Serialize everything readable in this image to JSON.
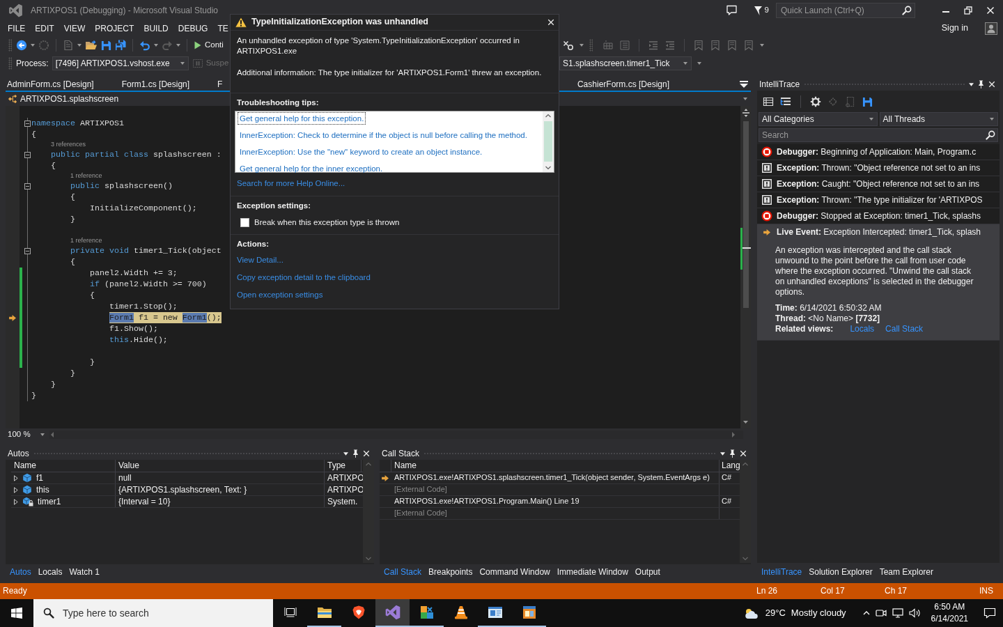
{
  "window": {
    "title": "ARTIXPOS1 (Debugging) - Microsoft Visual Studio",
    "notification_count": "9",
    "quick_launch": {
      "placeholder": "Quick Launch (Ctrl+Q)"
    },
    "sign_in": "Sign in"
  },
  "menu": [
    "FILE",
    "EDIT",
    "VIEW",
    "PROJECT",
    "BUILD",
    "DEBUG",
    "TE"
  ],
  "toolbar": {
    "continue": {
      "label": "Conti",
      "disabled": false
    },
    "process": {
      "label": "Process:",
      "value": "[7496] ARTIXPOS1.vshost.exe"
    },
    "suspend": {
      "label": "Suspe",
      "disabled": true
    },
    "stack_frame": {
      "value": "S1.splashscreen.timer1_Tick"
    }
  },
  "document_tabs": [
    {
      "label": "AdminForm.cs [Design]",
      "selected": false
    },
    {
      "label": "Form1.cs [Design]",
      "selected": false
    },
    {
      "label": "F",
      "selected": false
    },
    {
      "label": "CashierForm.cs [Design]",
      "selected": false
    }
  ],
  "editor": {
    "type_scope": "ARTIXPOS1.splashscreen",
    "zoom": "100 %",
    "lines": [
      {
        "kind": "header",
        "tokens": [
          {
            "text": "namespace",
            "kind": "keyword"
          },
          {
            "text": " ARTIXPOS1",
            "kind": "plain"
          }
        ],
        "expanded": true,
        "current": false,
        "changed": false
      },
      {
        "kind": "code",
        "tokens": [
          {
            "text": "{",
            "kind": "plain"
          }
        ],
        "current": false,
        "changed": false
      },
      {
        "kind": "lens",
        "text": "    3 references",
        "changed": false
      },
      {
        "kind": "header",
        "tokens": [
          {
            "text": "    public partial class",
            "kind": "keyword"
          },
          {
            "text": " splashscreen :",
            "kind": "plain"
          }
        ],
        "expanded": true,
        "current": false,
        "changed": false
      },
      {
        "kind": "code",
        "tokens": [
          {
            "text": "    {",
            "kind": "plain"
          }
        ],
        "current": false,
        "changed": false
      },
      {
        "kind": "lens",
        "text": "        1 reference",
        "changed": false
      },
      {
        "kind": "header",
        "tokens": [
          {
            "text": "        public",
            "kind": "keyword"
          },
          {
            "text": " splashscreen()",
            "kind": "plain"
          }
        ],
        "expanded": true,
        "current": false,
        "changed": false
      },
      {
        "kind": "code",
        "tokens": [
          {
            "text": "        {",
            "kind": "plain"
          }
        ],
        "current": false,
        "changed": false
      },
      {
        "kind": "code",
        "tokens": [
          {
            "text": "            InitializeComponent();",
            "kind": "plain"
          }
        ],
        "current": false,
        "changed": false
      },
      {
        "kind": "code",
        "tokens": [
          {
            "text": "        }",
            "kind": "plain"
          }
        ],
        "current": false,
        "changed": false
      },
      {
        "kind": "blank"
      },
      {
        "kind": "lens",
        "text": "        1 reference",
        "changed": false
      },
      {
        "kind": "header",
        "tokens": [
          {
            "text": "        private void",
            "kind": "keyword"
          },
          {
            "text": " timer1_Tick(object",
            "kind": "plain"
          }
        ],
        "expanded": true,
        "current": false,
        "changed": false
      },
      {
        "kind": "code",
        "tokens": [
          {
            "text": "        {",
            "kind": "plain"
          }
        ],
        "current": false,
        "changed": false
      },
      {
        "kind": "code",
        "tokens": [
          {
            "text": "            panel2.Width += 3;",
            "kind": "plain"
          }
        ],
        "current": false,
        "changed": true
      },
      {
        "kind": "code",
        "tokens": [
          {
            "text": "            if",
            "kind": "keyword"
          },
          {
            "text": " (panel2.Width >= 700)",
            "kind": "plain"
          }
        ],
        "current": false,
        "changed": true
      },
      {
        "kind": "code",
        "tokens": [
          {
            "text": "            {",
            "kind": "plain"
          }
        ],
        "current": false,
        "changed": true
      },
      {
        "kind": "code",
        "tokens": [
          {
            "text": "                timer1.Stop();",
            "kind": "plain"
          }
        ],
        "current": false,
        "changed": true
      },
      {
        "kind": "code",
        "tokens": [
          {
            "text": "                Form1",
            "kind": "reference"
          },
          {
            "text": " f1 = new ",
            "kind": "plain"
          },
          {
            "text": "Form1",
            "kind": "reference"
          },
          {
            "text": "();",
            "kind": "plain"
          }
        ],
        "current": true,
        "changed": true
      },
      {
        "kind": "code",
        "tokens": [
          {
            "text": "                f1.Show();",
            "kind": "plain"
          }
        ],
        "current": false,
        "changed": true
      },
      {
        "kind": "code",
        "tokens": [
          {
            "text": "                this",
            "kind": "keyword"
          },
          {
            "text": ".Hide();",
            "kind": "plain"
          }
        ],
        "current": false,
        "changed": true
      },
      {
        "kind": "blank"
      },
      {
        "kind": "code",
        "tokens": [
          {
            "text": "            }",
            "kind": "plain"
          }
        ],
        "current": false,
        "changed": true
      },
      {
        "kind": "code",
        "tokens": [
          {
            "text": "        }",
            "kind": "plain"
          }
        ],
        "current": false,
        "changed": false
      },
      {
        "kind": "code",
        "tokens": [
          {
            "text": "    }",
            "kind": "plain"
          }
        ],
        "current": false,
        "changed": false
      },
      {
        "kind": "code",
        "tokens": [
          {
            "text": "}",
            "kind": "plain"
          }
        ],
        "current": false,
        "changed": false
      }
    ]
  },
  "exception_dialog": {
    "title": "TypeInitializationException was unhandled",
    "message": "An unhandled exception of type 'System.TypeInitializationException' occurred in ARTIXPOS1.exe",
    "additional_info": "Additional information: The type initializer for 'ARTIXPOS1.Form1' threw an exception.",
    "tips_heading": "Troubleshooting tips:",
    "tips": [
      {
        "text": "Get general help for this exception.",
        "selected": true
      },
      {
        "text": "InnerException: Check to determine if the object is null before calling the method.",
        "selected": false
      },
      {
        "text": "InnerException: Use the \"new\" keyword to create an object instance.",
        "selected": false
      },
      {
        "text": "Get general help for the inner exception.",
        "selected": false
      }
    ],
    "help_link": "Search for more Help Online...",
    "settings_heading": "Exception settings:",
    "break_option": {
      "label": "Break when this exception type is thrown",
      "checked": false
    },
    "actions_heading": "Actions:",
    "actions": [
      "View Detail...",
      "Copy exception detail to the clipboard",
      "Open exception settings"
    ]
  },
  "intellitrace": {
    "title": "IntelliTrace",
    "category_filter": "All Categories",
    "thread_filter": "All Threads",
    "search": {
      "placeholder": "Search"
    },
    "events": [
      {
        "kind": "debugger",
        "text": "**Debugger:** Beginning of Application: Main, Program.c",
        "selected": false
      },
      {
        "kind": "exception",
        "text": "**Exception:** Thrown: \"Object reference not set to an ins",
        "selected": false
      },
      {
        "kind": "exception",
        "text": "**Exception:** Caught: \"Object reference not set to an ins",
        "selected": false
      },
      {
        "kind": "exception",
        "text": "**Exception:** Thrown: \"The type initializer for 'ARTIXPOS",
        "selected": false
      },
      {
        "kind": "debugger",
        "text": "**Debugger:** Stopped at Exception: timer1_Tick, splashs",
        "selected": false
      },
      {
        "kind": "live",
        "text": "**Live Event:** Exception Intercepted: timer1_Tick, splash",
        "selected": true,
        "details": {
          "description": "An exception was intercepted and the call stack unwound to the point before the call from user code where the exception occurred.  \"Unwind the call stack on unhandled exceptions\" is selected in the debugger options.",
          "time": "**Time:**  6/14/2021 6:50:32 AM",
          "thread": "**Thread:** <No Name> **[7732]**",
          "related_label": "Related views:",
          "related_links": [
            "Locals",
            "Call Stack"
          ]
        }
      }
    ],
    "tabs": [
      {
        "label": "IntelliTrace",
        "selected": true
      },
      {
        "label": "Solution Explorer",
        "selected": false
      },
      {
        "label": "Team Explorer",
        "selected": false
      }
    ]
  },
  "autos": {
    "title": "Autos",
    "columns": [
      "Name",
      "Value",
      "Type"
    ],
    "rows": [
      {
        "kind": "field",
        "name": "f1",
        "value": "null",
        "type": "ARTIXPO",
        "expanded": false
      },
      {
        "kind": "field",
        "name": "this",
        "value": "{ARTIXPOS1.splashscreen, Text: }",
        "type": "ARTIXPO",
        "expanded": false
      },
      {
        "kind": "private_field",
        "name": "timer1",
        "value": "{Interval = 10}",
        "type": "System.",
        "expanded": false
      }
    ],
    "tabs": [
      {
        "label": "Autos",
        "selected": true
      },
      {
        "label": "Locals",
        "selected": false
      },
      {
        "label": "Watch 1",
        "selected": false
      }
    ]
  },
  "call_stack": {
    "title": "Call Stack",
    "columns": [
      "Name",
      "Lang"
    ],
    "rows": [
      {
        "kind": "frame",
        "name": "ARTIXPOS1.exe!ARTIXPOS1.splashscreen.timer1_Tick(object sender, System.EventArgs e)",
        "lang": "C#",
        "current": true
      },
      {
        "kind": "external",
        "name": "[External Code]",
        "current": false
      },
      {
        "kind": "frame",
        "name": "ARTIXPOS1.exe!ARTIXPOS1.Program.Main() Line 19",
        "lang": "C#",
        "current": false
      },
      {
        "kind": "external",
        "name": "[External Code]",
        "current": false
      }
    ],
    "tabs": [
      {
        "label": "Call Stack",
        "selected": true
      },
      {
        "label": "Breakpoints",
        "selected": false
      },
      {
        "label": "Command Window",
        "selected": false
      },
      {
        "label": "Immediate Window",
        "selected": false
      },
      {
        "label": "Output",
        "selected": false
      }
    ]
  },
  "status_bar": {
    "text": "Ready",
    "line": "Ln 26",
    "column": "Col 17",
    "char": "Ch 17",
    "mode": "INS"
  },
  "taskbar": {
    "search": {
      "placeholder": "Type here to search"
    },
    "apps": [
      {
        "running": true,
        "active": false
      },
      {
        "running": false,
        "active": false
      },
      {
        "running": true,
        "active": true
      },
      {
        "running": true,
        "active": false
      },
      {
        "running": false,
        "active": false
      },
      {
        "running": true,
        "active": false
      },
      {
        "running": true,
        "active": false
      }
    ],
    "temperature": "29°C",
    "weather": "Mostly cloudy",
    "time": "6:50 AM",
    "date": "6/14/2021"
  }
}
